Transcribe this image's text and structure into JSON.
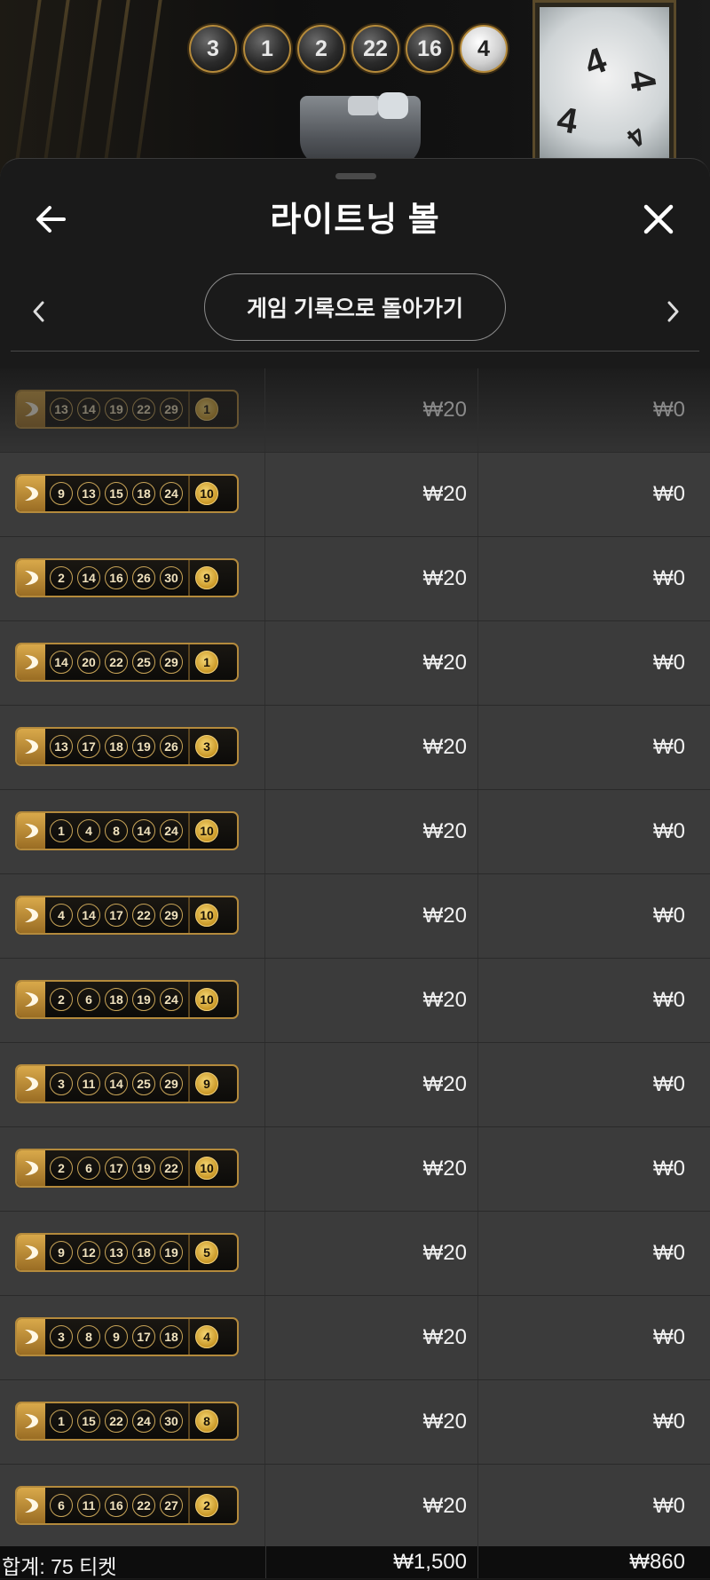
{
  "video": {
    "result_balls": [
      "3",
      "1",
      "2",
      "22",
      "16",
      "4"
    ],
    "screen_digits": [
      "4",
      "4",
      "4",
      "4"
    ]
  },
  "sheet": {
    "title": "라이트닝 볼",
    "back_icon": "arrow-left-icon",
    "close_icon": "close-icon",
    "history_button_label": "게임 기록으로 돌아가기",
    "prev_icon": "chevron-left-icon",
    "next_icon": "chevron-right-icon"
  },
  "tickets": [
    {
      "numbers": [
        "13",
        "14",
        "19",
        "22",
        "29"
      ],
      "multiplier": "1",
      "bet": "₩20",
      "win": "₩0"
    },
    {
      "numbers": [
        "9",
        "13",
        "15",
        "18",
        "24"
      ],
      "multiplier": "10",
      "bet": "₩20",
      "win": "₩0"
    },
    {
      "numbers": [
        "2",
        "14",
        "16",
        "26",
        "30"
      ],
      "multiplier": "9",
      "bet": "₩20",
      "win": "₩0"
    },
    {
      "numbers": [
        "14",
        "20",
        "22",
        "25",
        "29"
      ],
      "multiplier": "1",
      "bet": "₩20",
      "win": "₩0"
    },
    {
      "numbers": [
        "13",
        "17",
        "18",
        "19",
        "26"
      ],
      "multiplier": "3",
      "bet": "₩20",
      "win": "₩0"
    },
    {
      "numbers": [
        "1",
        "4",
        "8",
        "14",
        "24"
      ],
      "multiplier": "10",
      "bet": "₩20",
      "win": "₩0"
    },
    {
      "numbers": [
        "4",
        "14",
        "17",
        "22",
        "29"
      ],
      "multiplier": "10",
      "bet": "₩20",
      "win": "₩0"
    },
    {
      "numbers": [
        "2",
        "6",
        "18",
        "19",
        "24"
      ],
      "multiplier": "10",
      "bet": "₩20",
      "win": "₩0"
    },
    {
      "numbers": [
        "3",
        "11",
        "14",
        "25",
        "29"
      ],
      "multiplier": "9",
      "bet": "₩20",
      "win": "₩0"
    },
    {
      "numbers": [
        "2",
        "6",
        "17",
        "19",
        "22"
      ],
      "multiplier": "10",
      "bet": "₩20",
      "win": "₩0"
    },
    {
      "numbers": [
        "9",
        "12",
        "13",
        "18",
        "19"
      ],
      "multiplier": "5",
      "bet": "₩20",
      "win": "₩0"
    },
    {
      "numbers": [
        "3",
        "8",
        "9",
        "17",
        "18"
      ],
      "multiplier": "4",
      "bet": "₩20",
      "win": "₩0"
    },
    {
      "numbers": [
        "1",
        "15",
        "22",
        "24",
        "30"
      ],
      "multiplier": "8",
      "bet": "₩20",
      "win": "₩0"
    },
    {
      "numbers": [
        "6",
        "11",
        "16",
        "22",
        "27"
      ],
      "multiplier": "2",
      "bet": "₩20",
      "win": "₩0"
    }
  ],
  "total": {
    "label": "합계: 75 티켓",
    "bet": "₩1,500",
    "win": "₩860"
  },
  "colors": {
    "gold": "#b48a3c",
    "row_bg": "#3b3b3b",
    "sheet_bg": "#1a1a1a"
  }
}
